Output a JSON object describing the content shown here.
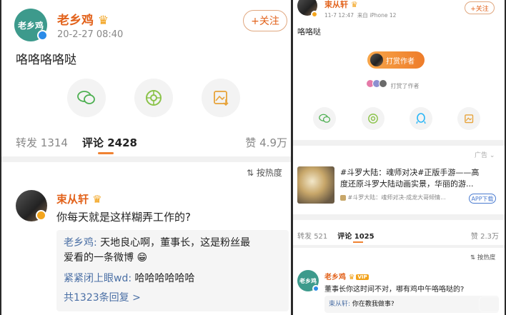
{
  "left": {
    "post": {
      "author": "老乡鸡",
      "avatar_text": "老乡鸡",
      "time": "20-2-27 08:40",
      "follow": "+关注",
      "text": "咯咯咯咯哒"
    },
    "share_icons": [
      "wechat-icon",
      "moments-icon",
      "save-image-icon"
    ],
    "tabs": {
      "repost_label": "转发",
      "repost_count": "1314",
      "comment_label": "评论",
      "comment_count": "2428",
      "like_label": "赞",
      "like_count": "4.9万"
    },
    "sort_label": "按热度",
    "comment": {
      "author": "束从轩",
      "text": "你每天就是这样糊弄工作的?",
      "replies": [
        {
          "author": "老乡鸡:",
          "text_line1": " 天地良心啊，董事长，这是粉丝最",
          "text_line2": "爱看的一条微博"
        },
        {
          "author": "紧紧闭上眼wd:",
          "text": " 哈哈哈哈哈哈"
        }
      ],
      "more": "共1323条回复 >"
    }
  },
  "right": {
    "post": {
      "author": "束从轩",
      "time": "11-7 12:47",
      "source": "来自 iPhone 12",
      "follow": "+关注",
      "text": "咯咯哒"
    },
    "reward_button": "打赏作者",
    "reward_note": "打赏了作者",
    "share_icons": [
      "wechat-icon",
      "moments-icon",
      "qq-icon",
      "save-image-icon"
    ],
    "ad": {
      "badge": "广告",
      "title_line1": "#斗罗大陆：魂师对决#正版手游——高",
      "title_line2": "度还原斗罗大陆动画实景，华丽的游...",
      "sub": "#斗罗大陆：魂师对决-成龙大哥倾情...",
      "download": "APP下载"
    },
    "tabs": {
      "repost_label": "转发",
      "repost_count": "521",
      "comment_label": "评论",
      "comment_count": "1025",
      "like_label": "赞",
      "like_count": "2.3万"
    },
    "sort_label": "按热度",
    "comment": {
      "author": "老乡鸡",
      "vip": "VIP",
      "avatar_text": "老乡鸡",
      "text": "董事长你这时间不对，哪有鸡中午咯咯哒的?",
      "reply_author": "束从轩:",
      "reply_text": " 你在教我做事?"
    }
  },
  "colors": {
    "accent": "#e2621b",
    "link_blue": "#4a6fa5",
    "verified_blue": "#2a8be8",
    "brand_green": "#3d9a8c"
  }
}
